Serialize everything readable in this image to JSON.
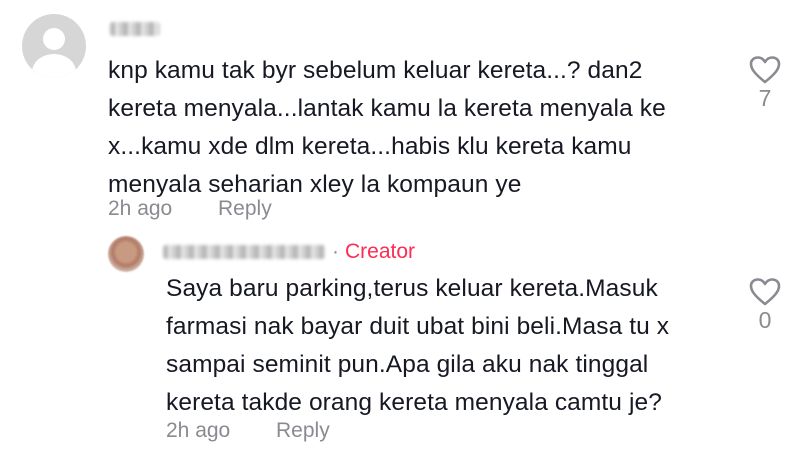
{
  "comments": [
    {
      "text": "knp kamu tak byr sebelum keluar kereta...? dan2\nkereta menyala...lantak kamu la kereta menyala ke\nx...kamu xde dlm kereta...habis klu kereta kamu\nmenyala seharian xley la kompaun ye",
      "time": "2h ago",
      "reply_label": "Reply",
      "likes": "7"
    }
  ],
  "replies": [
    {
      "creator_separator": "·",
      "creator_badge": "Creator",
      "text": "Saya baru parking,terus keluar kereta.Masuk\nfarmasi nak bayar duit ubat bini beli.Masa tu x\nsampai seminit pun.Apa gila aku nak tinggal\nkereta takde orang kereta menyala camtu je?",
      "time": "2h ago",
      "reply_label": "Reply",
      "likes": "0"
    }
  ],
  "icons": {
    "like": "heart-outline-icon",
    "avatar_default": "default-user-icon"
  },
  "colors": {
    "text": "#161823",
    "secondary": "#8a8b91",
    "creator": "#fe2c55"
  }
}
